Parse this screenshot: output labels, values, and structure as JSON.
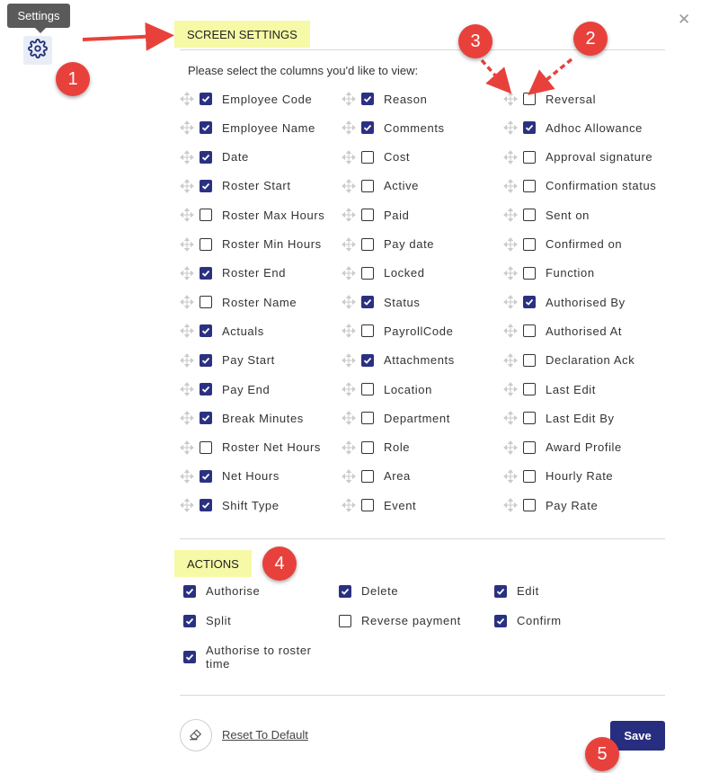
{
  "tooltip": "Settings",
  "screen_settings": {
    "title": "SCREEN SETTINGS",
    "instruction": "Please select the columns you'd like to view:",
    "columns": [
      [
        {
          "label": "Employee Code",
          "checked": true
        },
        {
          "label": "Employee Name",
          "checked": true
        },
        {
          "label": "Date",
          "checked": true
        },
        {
          "label": "Roster Start",
          "checked": true
        },
        {
          "label": "Roster Max Hours",
          "checked": false
        },
        {
          "label": "Roster Min Hours",
          "checked": false
        },
        {
          "label": "Roster End",
          "checked": true
        },
        {
          "label": "Roster Name",
          "checked": false
        },
        {
          "label": "Actuals",
          "checked": true
        },
        {
          "label": "Pay Start",
          "checked": true
        },
        {
          "label": "Pay End",
          "checked": true
        },
        {
          "label": "Break Minutes",
          "checked": true
        },
        {
          "label": "Roster Net Hours",
          "checked": false
        },
        {
          "label": "Net Hours",
          "checked": true
        },
        {
          "label": "Shift Type",
          "checked": true
        }
      ],
      [
        {
          "label": "Reason",
          "checked": true
        },
        {
          "label": "Comments",
          "checked": true
        },
        {
          "label": "Cost",
          "checked": false
        },
        {
          "label": "Active",
          "checked": false
        },
        {
          "label": "Paid",
          "checked": false
        },
        {
          "label": "Pay date",
          "checked": false
        },
        {
          "label": "Locked",
          "checked": false
        },
        {
          "label": "Status",
          "checked": true
        },
        {
          "label": "PayrollCode",
          "checked": false
        },
        {
          "label": "Attachments",
          "checked": true
        },
        {
          "label": "Location",
          "checked": false
        },
        {
          "label": "Department",
          "checked": false
        },
        {
          "label": "Role",
          "checked": false
        },
        {
          "label": "Area",
          "checked": false
        },
        {
          "label": "Event",
          "checked": false
        }
      ],
      [
        {
          "label": "Reversal",
          "checked": false
        },
        {
          "label": "Adhoc Allowance",
          "checked": true
        },
        {
          "label": "Approval signature",
          "checked": false
        },
        {
          "label": "Confirmation status",
          "checked": false
        },
        {
          "label": "Sent on",
          "checked": false
        },
        {
          "label": "Confirmed on",
          "checked": false
        },
        {
          "label": "Function",
          "checked": false
        },
        {
          "label": "Authorised By",
          "checked": true
        },
        {
          "label": "Authorised At",
          "checked": false
        },
        {
          "label": "Declaration Ack",
          "checked": false
        },
        {
          "label": "Last Edit",
          "checked": false
        },
        {
          "label": "Last Edit By",
          "checked": false
        },
        {
          "label": "Award Profile",
          "checked": false
        },
        {
          "label": "Hourly Rate",
          "checked": false
        },
        {
          "label": "Pay Rate",
          "checked": false
        }
      ]
    ]
  },
  "actions": {
    "title": "ACTIONS",
    "items": [
      {
        "label": "Authorise",
        "checked": true
      },
      {
        "label": "Delete",
        "checked": true
      },
      {
        "label": "Edit",
        "checked": true
      },
      {
        "label": "Split",
        "checked": true
      },
      {
        "label": "Reverse payment",
        "checked": false
      },
      {
        "label": "Confirm",
        "checked": true
      },
      {
        "label": "Authorise to roster time",
        "checked": true
      }
    ]
  },
  "footer": {
    "reset_label": "Reset To Default",
    "save_label": "Save"
  },
  "callouts": [
    "1",
    "2",
    "3",
    "4",
    "5"
  ],
  "colors": {
    "accent": "#272e7f",
    "callout": "#e8413b",
    "highlight": "#f6f9a5"
  }
}
